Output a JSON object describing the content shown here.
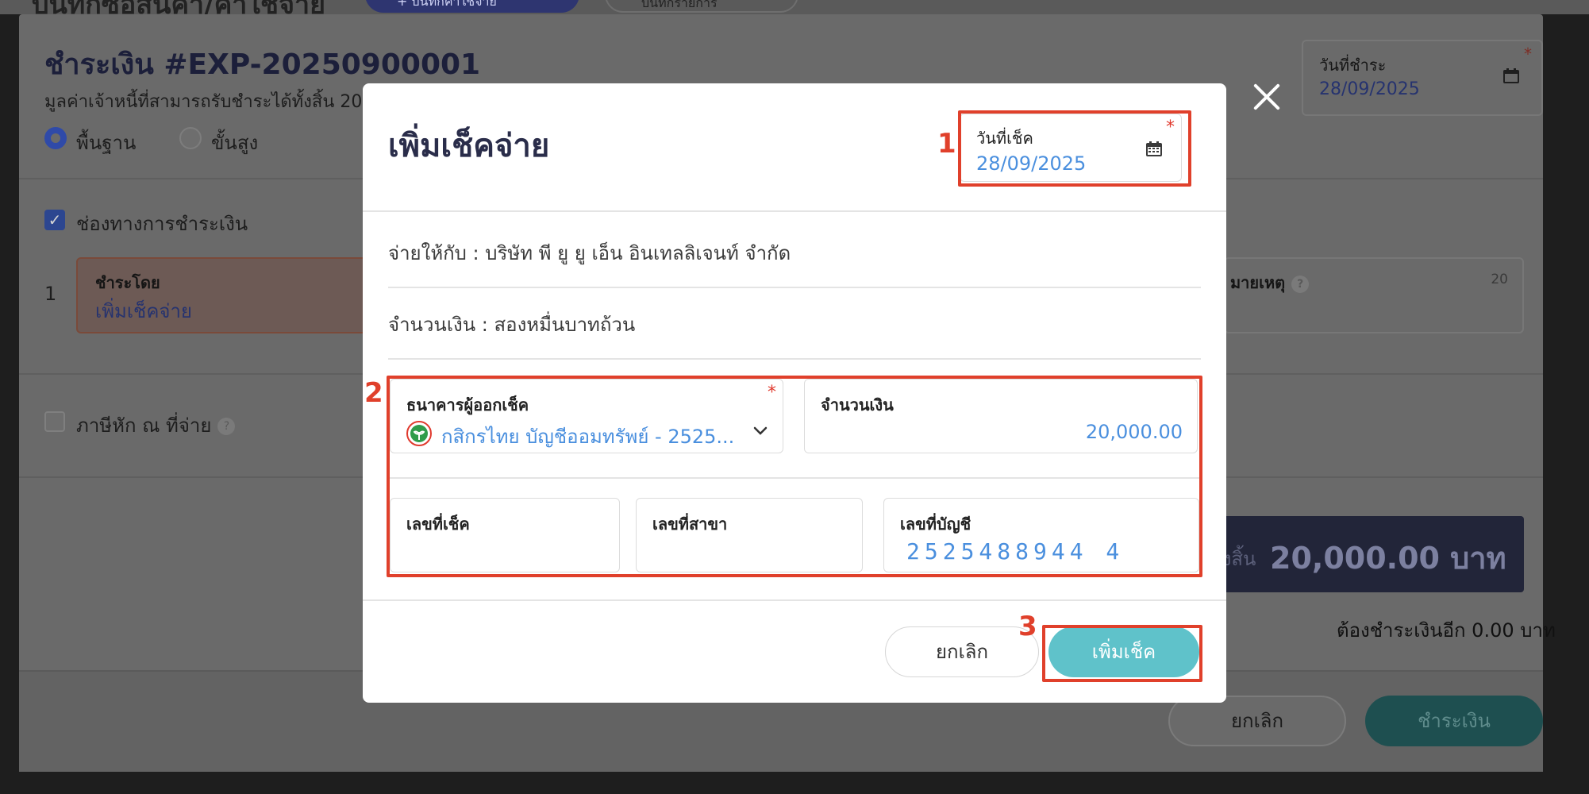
{
  "background": {
    "page_title": "บันทึกซื้อสินค้า/ค่าใช้จ่าย",
    "top_button_1": "+ บันทึกค่าใช้จ่าย",
    "top_button_2": "บันทึกรายการ",
    "payment_title": "ชำระเงิน #EXP-20250900001",
    "payment_subtitle": "มูลค่าเจ้าหนี้ที่สามารถรับชำระได้ทั้งสิ้น 20",
    "mode_basic": "พื้นฐาน",
    "mode_advanced": "ขั้นสูง",
    "payment_date_label": "วันที่ชำระ",
    "payment_date_value": "28/09/2025",
    "payment_channel_label": "ช่องทางการชำระเงิน",
    "row_index": "1",
    "pay_by_label": "ชำระโดย",
    "pay_by_value": "เพิ่มเช็คจ่าย",
    "note_label": "มายเหตุ",
    "note_count": "20",
    "withholding_label": "ภาษีหัก ณ ที่จ่าย",
    "total_label": "มทั้งสิ้น",
    "total_value": "20,000.00 บาท",
    "remaining_text": "ต้องชำระเงินอีก 0.00 บาท",
    "cancel_button": "ยกเลิก",
    "pay_button": "ชำระเงิน"
  },
  "modal": {
    "title": "เพิ่มเช็คจ่าย",
    "check_date_label": "วันที่เช็ค",
    "check_date_value": "28/09/2025",
    "pay_to_text": "จ่ายให้กับ : บริษัท พี ยู ยู เอ็น อินเทลลิเจนท์ จำกัด",
    "amount_text": "จำนวนเงิน : สองหมื่นบาทถ้วน",
    "bank_label": "ธนาคารผู้ออกเช็ค",
    "bank_value": "กสิกรไทย บัญชีออมทรัพย์ - 2525...",
    "amount_label": "จำนวนเงิน",
    "amount_value": "20,000.00",
    "check_no_label": "เลขที่เช็ค",
    "branch_no_label": "เลขที่สาขา",
    "account_no_label": "เลขที่บัญชี",
    "account_no_value": "2525488944 4",
    "cancel_button": "ยกเลิก",
    "add_button": "เพิ่มเช็ค"
  },
  "annotations": [
    "1",
    "2",
    "3"
  ],
  "colors": {
    "highlight": "#e0402b",
    "accent_teal": "#5fc2ca",
    "value_blue": "#4a8fde",
    "required_red": "#e03a2e"
  },
  "icons": {
    "calendar": "calendar-icon",
    "chevron": "chevron-down-icon",
    "close": "close-icon",
    "bank_logo": "kasikorn-bank-icon",
    "help": "help-icon"
  }
}
